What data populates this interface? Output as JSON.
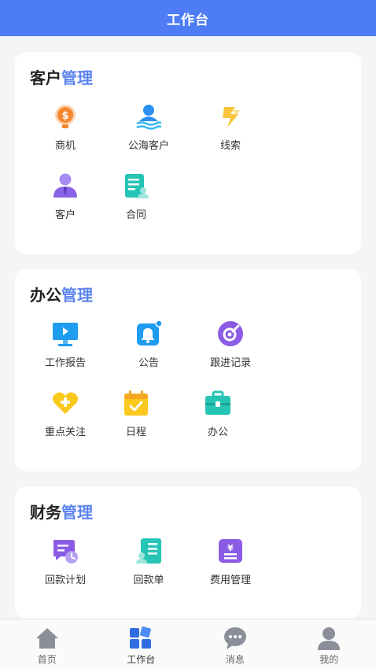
{
  "header": {
    "title": "工作台"
  },
  "sections": [
    {
      "title_main": "客户",
      "title_accent": "管理",
      "items": [
        {
          "label": "商机",
          "icon": "money-bulb-icon"
        },
        {
          "label": "公海客户",
          "icon": "public-customer-icon"
        },
        {
          "label": "线索",
          "icon": "lightning-icon"
        },
        {
          "label": "客户",
          "icon": "customer-icon"
        },
        {
          "label": "合同",
          "icon": "contract-icon"
        }
      ]
    },
    {
      "title_main": "办公",
      "title_accent": "管理",
      "items": [
        {
          "label": "工作报告",
          "icon": "monitor-icon"
        },
        {
          "label": "公告",
          "icon": "bell-icon"
        },
        {
          "label": "跟进记录",
          "icon": "follow-up-icon"
        },
        {
          "label": "重点关注",
          "icon": "heart-icon"
        },
        {
          "label": "日程",
          "icon": "calendar-icon"
        },
        {
          "label": "办公",
          "icon": "briefcase-icon"
        }
      ]
    },
    {
      "title_main": "财务",
      "title_accent": "管理",
      "items": [
        {
          "label": "回款计划",
          "icon": "payment-plan-icon"
        },
        {
          "label": "回款单",
          "icon": "payment-receipt-icon"
        },
        {
          "label": "费用管理",
          "icon": "expense-icon"
        }
      ]
    }
  ],
  "tabbar": [
    {
      "label": "首页",
      "icon": "home-icon"
    },
    {
      "label": "工作台",
      "icon": "workbench-icon",
      "active": true
    },
    {
      "label": "消息",
      "icon": "message-icon"
    },
    {
      "label": "我的",
      "icon": "profile-icon"
    }
  ]
}
